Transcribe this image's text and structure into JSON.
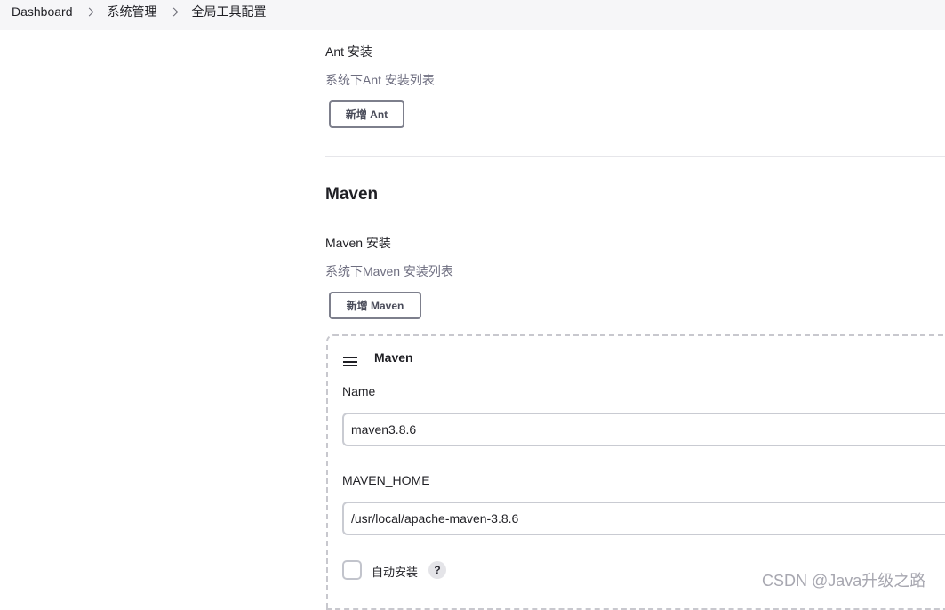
{
  "breadcrumb": {
    "items": [
      "Dashboard",
      "系统管理",
      "全局工具配置"
    ]
  },
  "ant": {
    "label": "Ant 安装",
    "description": "系统下Ant 安装列表",
    "add_button": "新增 Ant"
  },
  "maven": {
    "section_title": "Maven",
    "label": "Maven 安装",
    "description": "系统下Maven 安装列表",
    "add_button": "新增 Maven",
    "installation": {
      "title": "Maven",
      "name_label": "Name",
      "name_value": "maven3.8.6",
      "home_label": "MAVEN_HOME",
      "home_value": "/usr/local/apache-maven-3.8.6",
      "auto_install_label": "自动安装",
      "auto_install_checked": false,
      "help_glyph": "?"
    }
  },
  "watermark": "CSDN @Java升级之路",
  "icons": {
    "separator": "chevron-right-icon",
    "drag": "drag-handle-icon",
    "help": "help-icon"
  },
  "colors": {
    "header_bg": "#f6f6f8",
    "button_border": "#7d7f8c",
    "description": "#6e6e80",
    "card_border": "#c8c8ce"
  }
}
